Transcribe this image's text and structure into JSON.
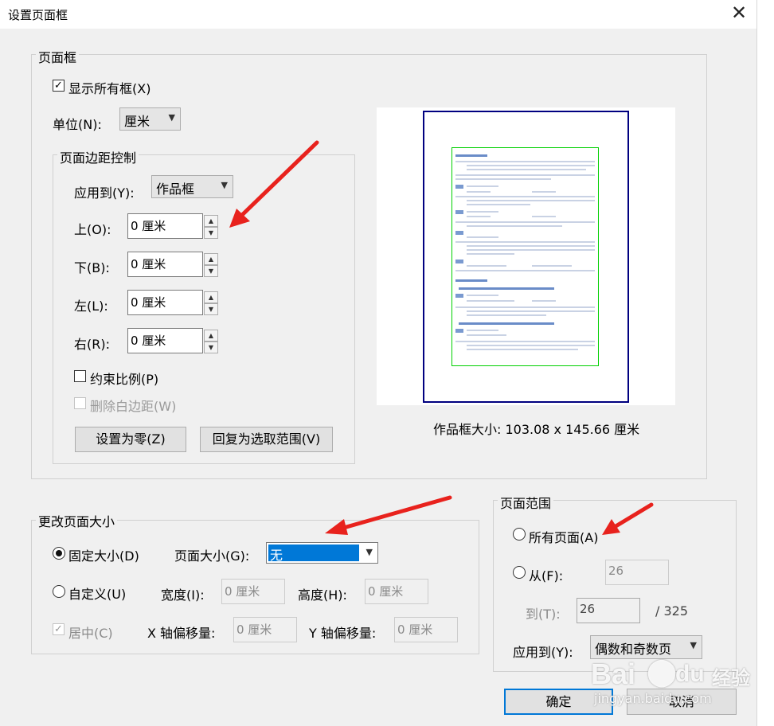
{
  "dialog": {
    "title": "设置页面框",
    "close_glyph": "✕"
  },
  "background": {
    "glyph": "("
  },
  "page_frame": {
    "legend": "页面框",
    "show_all": {
      "label": "显示所有框(X)",
      "checked": true
    },
    "unit": {
      "label": "单位(N):",
      "value": "厘米"
    },
    "margins": {
      "legend": "页面边距控制",
      "apply_to": {
        "label": "应用到(Y):",
        "value": "作品框"
      },
      "top": {
        "label": "上(O):",
        "value": "0 厘米"
      },
      "bottom": {
        "label": "下(B):",
        "value": "0 厘米"
      },
      "left": {
        "label": "左(L):",
        "value": "0 厘米"
      },
      "right": {
        "label": "右(R):",
        "value": "0 厘米"
      },
      "constrain": {
        "label": "约束比例(P)",
        "checked": false
      },
      "remove_white": {
        "label": "删除白边距(W)",
        "checked": false,
        "enabled": false
      },
      "set_zero_button": "设置为零(Z)",
      "revert_button": "回复为选取范围(V)"
    },
    "size_text": "作品框大小: 103.08 x 145.66 厘米"
  },
  "change_size": {
    "legend": "更改页面大小",
    "fixed": {
      "label": "固定大小(D)",
      "selected": true
    },
    "page_size": {
      "label": "页面大小(G):",
      "value": "无"
    },
    "custom": {
      "label": "自定义(U)",
      "selected": false
    },
    "width": {
      "label": "宽度(I):",
      "value": "0 厘米"
    },
    "height": {
      "label": "高度(H):",
      "value": "0 厘米"
    },
    "center": {
      "label": "居中(C)",
      "checked": true,
      "enabled": false
    },
    "x_offset": {
      "label": "X 轴偏移量:",
      "value": "0 厘米"
    },
    "y_offset": {
      "label": "Y 轴偏移量:",
      "value": "0 厘米"
    }
  },
  "page_range": {
    "legend": "页面范围",
    "all_pages": {
      "label": "所有页面(A)",
      "selected": false
    },
    "from": {
      "label": "从(F):",
      "value": "26"
    },
    "to": {
      "label": "到(T):",
      "value": "26"
    },
    "total": "/ 325",
    "apply_to": {
      "label": "应用到(Y):",
      "value": "偶数和奇数页"
    }
  },
  "buttons": {
    "ok": "确定",
    "cancel": "取消"
  },
  "watermark": {
    "logo": "Bai",
    "suffix": "经验",
    "url": "jingyan.baidu.com"
  },
  "colors": {
    "selection": "#0078d7",
    "arrow": "#e8221d",
    "page_border": "#000080",
    "content_border": "#00d000"
  }
}
